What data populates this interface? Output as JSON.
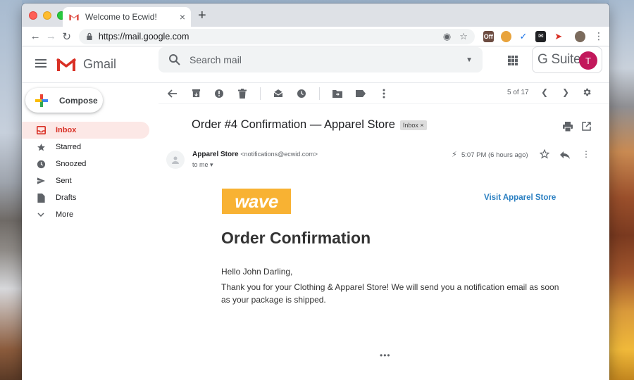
{
  "browser": {
    "tab_title": "Welcome to Ecwid!",
    "tab_close": "×",
    "new_tab": "+",
    "url": "https://mail.google.com",
    "ext_off_badge": "Off"
  },
  "gmail": {
    "brand": "Gmail",
    "search_placeholder": "Search mail",
    "gsuite_label": "G Suite",
    "avatar_initial": "T"
  },
  "sidebar": {
    "compose_label": "Compose",
    "items": [
      {
        "label": "Inbox",
        "icon": "inbox-icon",
        "active": true
      },
      {
        "label": "Starred",
        "icon": "star-icon",
        "active": false
      },
      {
        "label": "Snoozed",
        "icon": "clock-icon",
        "active": false
      },
      {
        "label": "Sent",
        "icon": "send-icon",
        "active": false
      },
      {
        "label": "Drafts",
        "icon": "draft-icon",
        "active": false
      },
      {
        "label": "More",
        "icon": "chevron-down-icon",
        "active": false
      }
    ]
  },
  "toolbar": {
    "pager": "5 of 17"
  },
  "email": {
    "subject": "Order #4 Confirmation — Apparel Store",
    "label_badge": "Inbox ×",
    "sender_name": "Apparel Store",
    "sender_email": "<notifications@ecwid.com>",
    "recipient": "to me",
    "time": "5:07 PM (6 hours ago)",
    "logo_text": "wave",
    "visit_link": "Visit Apparel Store",
    "heading": "Order Confirmation",
    "greeting": "Hello John Darling,",
    "body": "Thank you for your Clothing & Apparel Store! We will send you a notification email as soon as your package is shipped.",
    "ellipsis": "•••"
  },
  "colors": {
    "gmail_red": "#d93025",
    "wave_orange": "#f8b233",
    "link_blue": "#2a7fc1",
    "avatar_pink": "#c2185b"
  }
}
